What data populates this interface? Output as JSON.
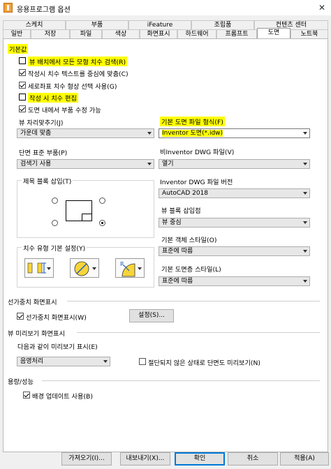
{
  "window": {
    "title": "응용프로그램 옵션"
  },
  "tabs_row1": [
    "스케치",
    "부품",
    "iFeature",
    "조립품",
    "컨텐츠 센터"
  ],
  "tabs_row2": [
    "일반",
    "저장",
    "파일",
    "색상",
    "화면표시",
    "하드웨어",
    "프롬프트",
    "도면",
    "노트북"
  ],
  "active_tab": "도면",
  "defaults": {
    "section_label": "기본값",
    "retrieve_all_dims": "뷰 배치에서 모든 모형 치수 검색(R)",
    "center_dim_text": "작성시 치수 텍스트를 중심에 맞춤(C)",
    "ordinate_dim_single": "세로좌표 치수 형상 선택 사용(G)",
    "edit_dim_on_create": "작성 시 치수 편집",
    "show_part_in_view": "도면 내에서 부품 수정 가능",
    "view_justification_label": "뷰 자리맞추기(J)",
    "view_justification_value": "가운데 맞춤",
    "section_std_parts_label": "단면 표준 부품(P)",
    "section_std_parts_value": "검색기 사용",
    "title_block_insert_label": "제목 블록 삽입(T)",
    "dim_type_label": "치수 유형 기본 설정(Y)",
    "default_drawing_type_label": "기본 도면 파일 형식(F)",
    "default_drawing_type_value": "Inventor 도면(*.idw)",
    "non_inventor_dwg_label": "비Inventor DWG 파일(V)",
    "non_inventor_dwg_value": "열기",
    "inventor_dwg_version_label": "Inventor DWG 파일 버전",
    "inventor_dwg_version_value": "AutoCAD 2018",
    "view_block_insert_label": "뷰 블록 삽입점",
    "view_block_insert_value": "뷰 중심",
    "default_object_style_label": "기본 객체 스타일(O)",
    "default_object_style_value": "표준에 따름",
    "default_layer_style_label": "기본 도면층 스타일(L)",
    "default_layer_style_value": "표준에 따름"
  },
  "lineweight": {
    "section_label": "선가중치 화면표시",
    "show_lineweight": "선가중치 화면표시(W)",
    "settings_button": "설정(S)..."
  },
  "view_preview": {
    "section_label": "뷰 미리보기 화면표시",
    "show_preview_as_label": "다음과 같이 미리보기 표시(E)",
    "show_preview_as_value": "음영처리",
    "section_unhatched": "절단되지 않은 상태로 단면도 미리보기(N)"
  },
  "capacity": {
    "section_label": "용량/성능",
    "bg_update": "배경 업데이트 사용(B)"
  },
  "footer": {
    "import_btn": "가져오기(I)...",
    "export_btn": "내보내기(X)...",
    "ok_btn": "확인",
    "cancel_btn": "취소",
    "apply_btn": "적용(A)"
  },
  "colors": {
    "highlight": "#ffff00",
    "accent": "#0078d7"
  }
}
